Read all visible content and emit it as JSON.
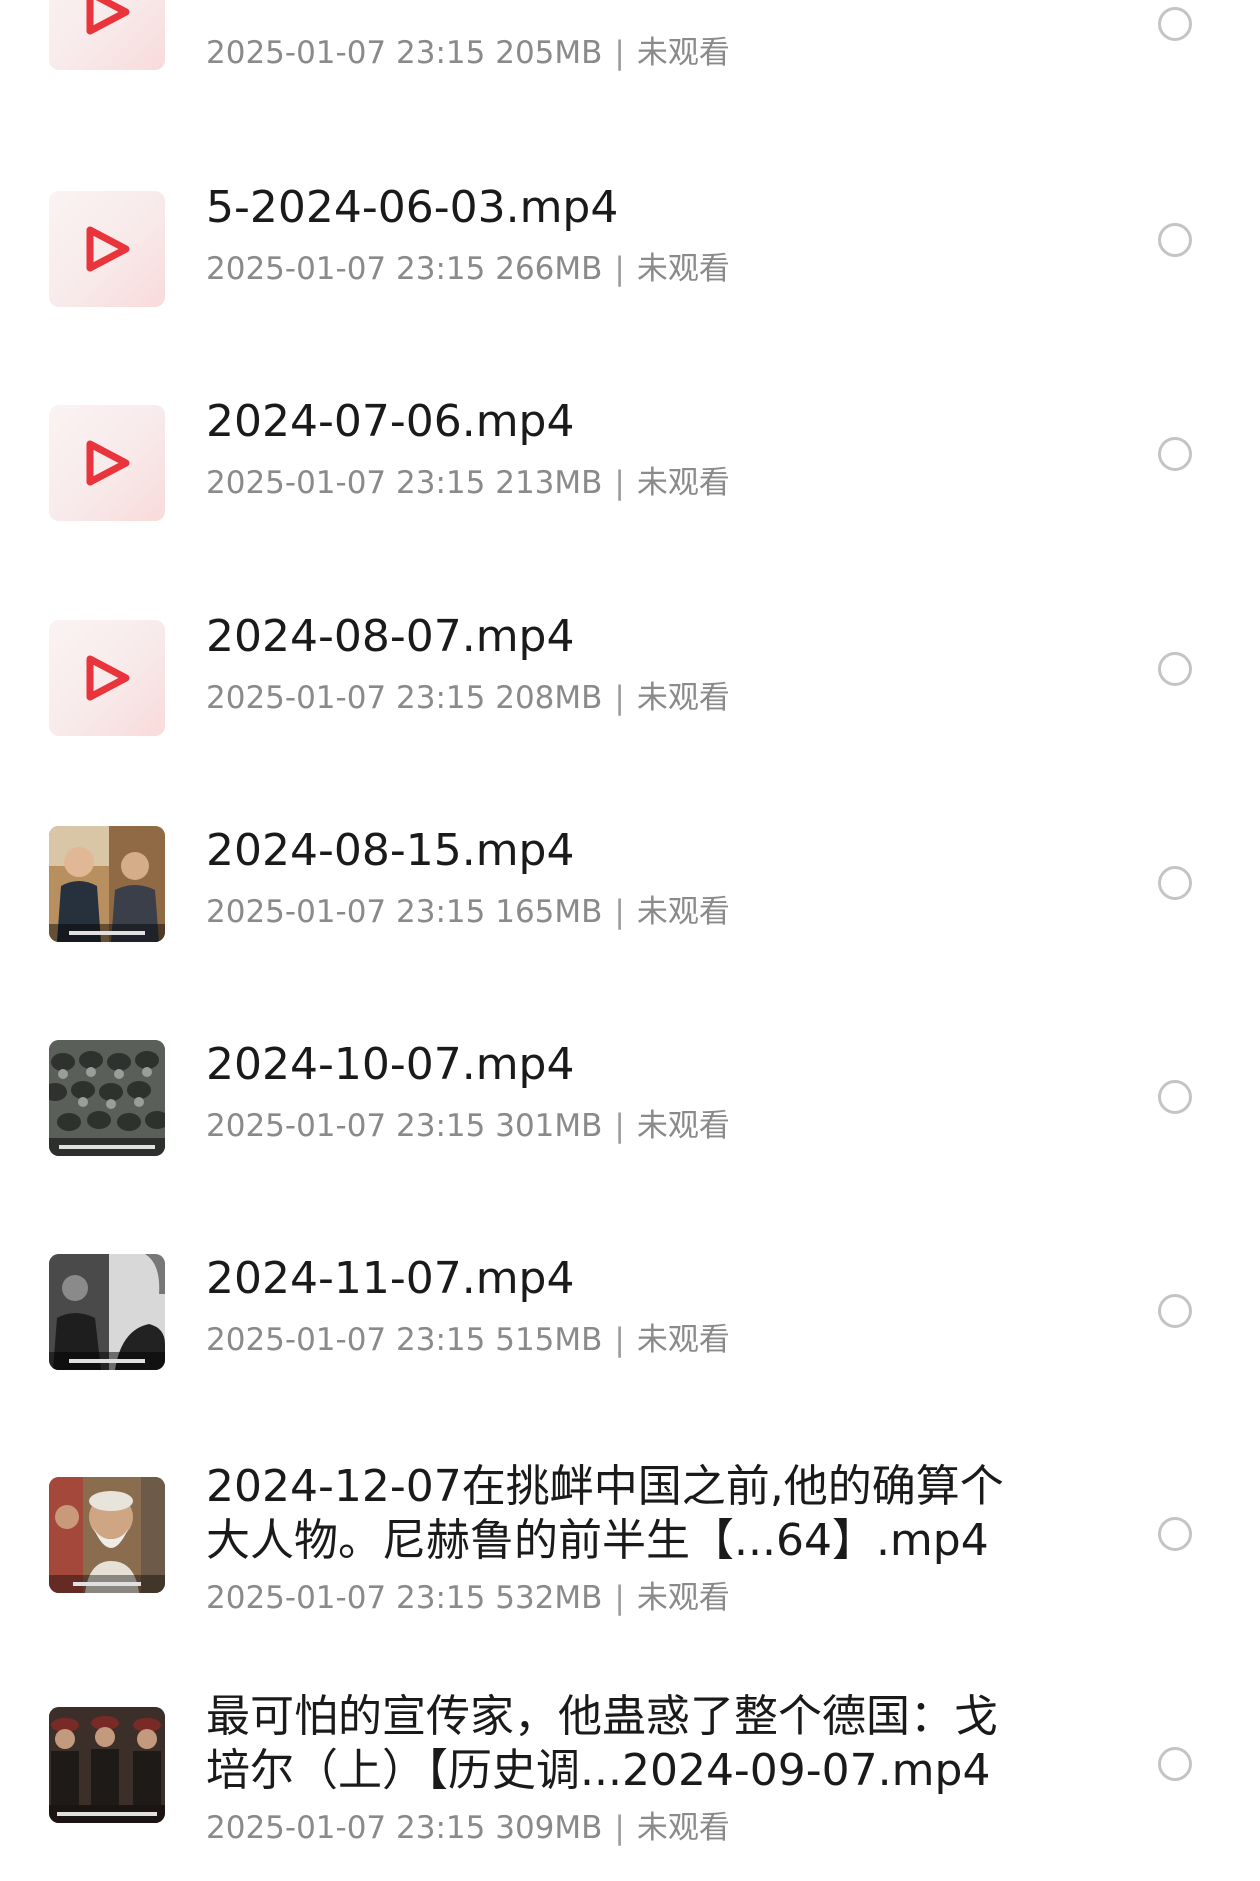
{
  "files": [
    {
      "title": "",
      "date": "2025-01-07 23:15",
      "size": "205MB",
      "status": "未观看",
      "thumb": "play-icon"
    },
    {
      "title": "5-2024-06-03.mp4",
      "date": "2025-01-07 23:15",
      "size": "266MB",
      "status": "未观看",
      "thumb": "play-icon"
    },
    {
      "title": "2024-07-06.mp4",
      "date": "2025-01-07 23:15",
      "size": "213MB",
      "status": "未观看",
      "thumb": "play-icon"
    },
    {
      "title": "2024-08-07.mp4",
      "date": "2025-01-07 23:15",
      "size": "208MB",
      "status": "未观看",
      "thumb": "play-icon"
    },
    {
      "title": "2024-08-15.mp4",
      "date": "2025-01-07 23:15",
      "size": "165MB",
      "status": "未观看",
      "thumb": "video-thumbnail"
    },
    {
      "title": "2024-10-07.mp4",
      "date": "2025-01-07 23:15",
      "size": "301MB",
      "status": "未观看",
      "thumb": "video-thumbnail"
    },
    {
      "title": "2024-11-07.mp4",
      "date": "2025-01-07 23:15",
      "size": "515MB",
      "status": "未观看",
      "thumb": "video-thumbnail"
    },
    {
      "title": "2024-12-07在挑衅中国之前,他的确算个大人物。尼赫鲁的前半生【...64】.mp4",
      "date": "2025-01-07 23:15",
      "size": "532MB",
      "status": "未观看",
      "thumb": "video-thumbnail"
    },
    {
      "title": "最可怕的宣传家，他蛊惑了整个德国：戈培尔（上）【历史调...2024-09-07.mp4",
      "date": "2025-01-07 23:15",
      "size": "309MB",
      "status": "未观看",
      "thumb": "video-thumbnail"
    }
  ],
  "colors": {
    "play_icon": "#e8343a",
    "title_text": "#1a1a1a",
    "meta_text": "#8a8a8a",
    "radio_border": "#c4c4c4"
  }
}
